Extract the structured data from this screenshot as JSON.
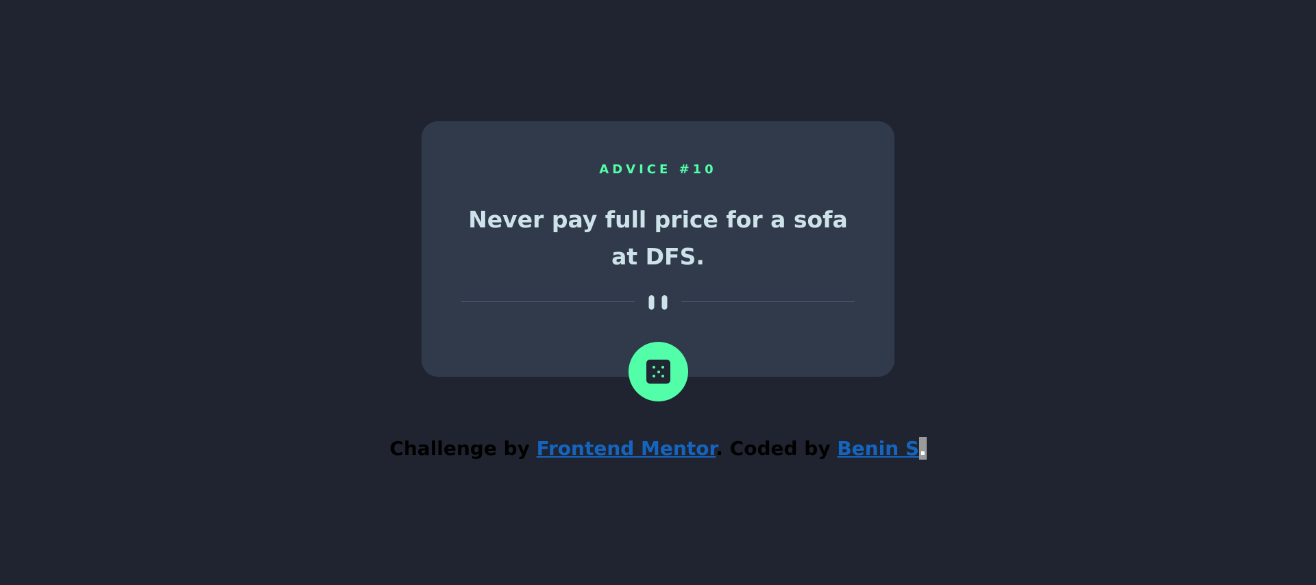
{
  "card": {
    "advice_label": "ADVICE #10",
    "advice_text": "Never pay full price for a sofa at DFS."
  },
  "divider": {
    "icon": "pause-icon"
  },
  "dice_button": {
    "icon": "dice-icon"
  },
  "attribution": {
    "prefix": "Challenge by ",
    "frontend_mentor": "Frontend Mentor",
    "middle": ". Coded by ",
    "author": "Benin S",
    "suffix": "."
  },
  "colors": {
    "background": "#1f2430",
    "card": "#313a4b",
    "accent": "#52ffa8",
    "text": "#cee3e9",
    "link": "#1565c0"
  }
}
